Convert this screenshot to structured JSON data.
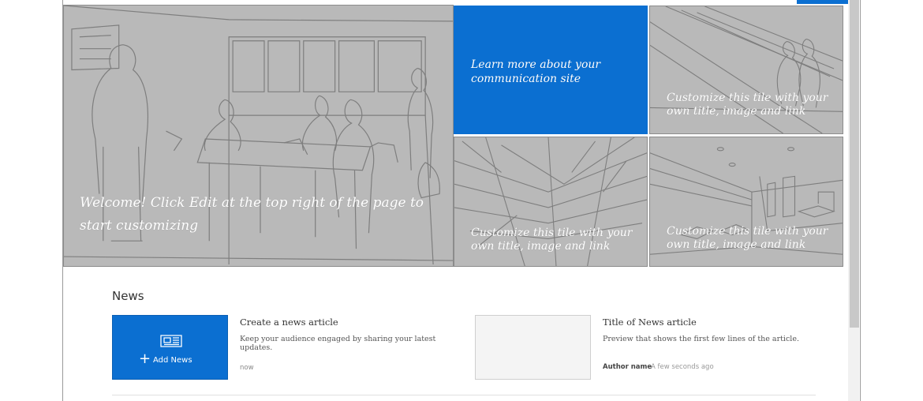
{
  "hero": {
    "main_tile": {
      "text": "Welcome! Click Edit at the top right of the page to start customizing"
    },
    "blue_tile": {
      "text": "Learn more about your communication site"
    },
    "tile_top_right": {
      "text": "Customize this tile with your own title, image and link"
    },
    "tile_bottom_left": {
      "text": "Customize this tile with your own title, image and link"
    },
    "tile_bottom_right": {
      "text": "Customize this tile with your own title, image and link"
    }
  },
  "news": {
    "heading": "News",
    "add_news_label": "Add News",
    "add_news_plus": "+",
    "create_article": {
      "title": "Create a news article",
      "description": "Keep your audience engaged by sharing your latest updates.",
      "time": "now"
    },
    "sample_article": {
      "title": "Title of News article",
      "description": "Preview that shows the first few lines of the article.",
      "author": "Author name",
      "time": "A few seconds ago"
    }
  },
  "colors": {
    "accent": "#0b6fd1",
    "tile_gray": "#b9b9b9"
  },
  "icons": [
    "news-icon",
    "plus-icon"
  ]
}
